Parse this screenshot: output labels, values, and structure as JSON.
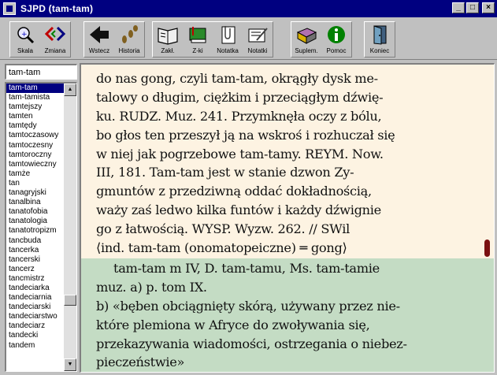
{
  "window": {
    "title": "SJPD  (tam-tam)",
    "min_label": "_",
    "max_label": "□",
    "close_label": "×"
  },
  "toolbar": {
    "buttons": [
      {
        "label": "Skala",
        "icon": "magnifier-icon"
      },
      {
        "label": "Zmiana",
        "icon": "swap-arrows-icon"
      },
      {
        "label": "Wstecz",
        "icon": "back-arrow-icon"
      },
      {
        "label": "Historia",
        "icon": "footprints-icon"
      },
      {
        "label": "Zakł.",
        "icon": "book-icon"
      },
      {
        "label": "Z-ki",
        "icon": "green-book-icon"
      },
      {
        "label": "Notatka",
        "icon": "paperclip-icon"
      },
      {
        "label": "Notatki",
        "icon": "notes-pencil-icon"
      },
      {
        "label": "Suplem.",
        "icon": "supplement-book-icon"
      },
      {
        "label": "Pomoc",
        "icon": "info-icon"
      },
      {
        "label": "Koniec",
        "icon": "exit-door-icon"
      }
    ]
  },
  "search": {
    "value": "tam-tam"
  },
  "wordlist": {
    "selected_index": 0,
    "items": [
      "tam-tam",
      "tam-tamista",
      "tamtejszy",
      "tamten",
      "tamtędy",
      "tamtoczasowy",
      "tamtoczesny",
      "tamtoroczny",
      "tamtowieczny",
      "tamże",
      "tan",
      "tanagryjski",
      "tanalbina",
      "tanatofobia",
      "tanatologia",
      "tanatotropizm",
      "tancbuda",
      "tancerka",
      "tancerski",
      "tancerz",
      "tancmistrz",
      "tandeciarka",
      "tandeciarnia",
      "tandeciarski",
      "tandeciarstwo",
      "tandeciarz",
      "tandecki",
      "tandem"
    ]
  },
  "content": {
    "top_lines": [
      "do nas gong, czyli tam-tam, okrągły dysk me-",
      "talowy o długim, ciężkim i przeciągłym dźwię-",
      "ku. RUDZ. Muz. 241. Przymknęła oczy z bólu,",
      "bo głos ten przeszył ją na wskroś i rozhuczał się",
      "w niej jak pogrzebowe tam-tamy. REYM. Now.",
      "III, 181. Tam-tam jest w stanie dzwon Zy-",
      "gmuntów z przedziwną oddać dokładnością,",
      "waży zaś ledwo kilka funtów i każdy dźwignie",
      "go z łatwością. WYSP. Wyzw. 262. // SWil",
      "⟨ind. tam-tam (onomatopeiczne) ═ gong⟩"
    ],
    "bottom_lines": [
      "tam-tam m IV, D. tam-tamu, Ms. tam-tamie",
      "muz. a) p. tom IX.",
      "b) «bęben obciągnięty skórą, używany przez nie-",
      "które plemiona w Afryce do zwoływania się,",
      "przekazywania wiadomości, ostrzegania o niebez-",
      "pieczeństwie»"
    ]
  },
  "colors": {
    "titlebar": "#000080",
    "page_top": "#fdf3e2",
    "page_bottom": "#c4dcc4",
    "scroll_thumb": "#7a1010",
    "selection": "#000080"
  }
}
